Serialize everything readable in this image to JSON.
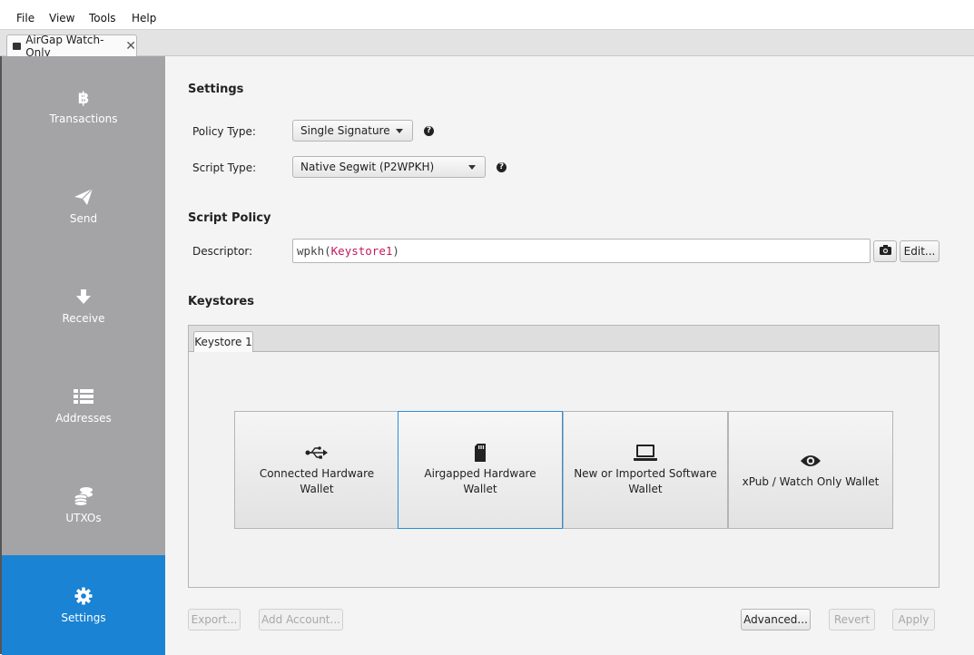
{
  "menu": [
    "File",
    "View",
    "Tools",
    "Help"
  ],
  "wallet_tab": {
    "title": "AirGap Watch-Only",
    "close": "✕"
  },
  "sidebar": {
    "items": [
      {
        "label": "Transactions",
        "icon": "bitcoin-icon",
        "active": false
      },
      {
        "label": "Send",
        "icon": "paper-plane-icon",
        "active": false
      },
      {
        "label": "Receive",
        "icon": "arrow-down-icon",
        "active": false
      },
      {
        "label": "Addresses",
        "icon": "list-icon",
        "active": false
      },
      {
        "label": "UTXOs",
        "icon": "coins-icon",
        "active": false
      },
      {
        "label": "Settings",
        "icon": "gear-icon",
        "active": true
      }
    ]
  },
  "settings": {
    "title": "Settings",
    "policy_type": {
      "label": "Policy Type:",
      "value": "Single Signature"
    },
    "script_type": {
      "label": "Script Type:",
      "value": "Native Segwit (P2WPKH)"
    }
  },
  "script_policy": {
    "title": "Script Policy",
    "descriptor_label": "Descriptor:",
    "descriptor": {
      "prefix": "wpkh(",
      "keystore": "Keystore1",
      "suffix": ")"
    },
    "edit_button": "Edit..."
  },
  "keystores": {
    "title": "Keystores",
    "tabs": [
      "Keystore 1"
    ],
    "options": [
      {
        "label": "Connected Hardware Wallet",
        "icon": "usb-icon",
        "selected": false
      },
      {
        "label": "Airgapped Hardware Wallet",
        "icon": "sd-card-icon",
        "selected": true
      },
      {
        "label": "New or Imported Software Wallet",
        "icon": "laptop-icon",
        "selected": false
      },
      {
        "label": "xPub / Watch Only Wallet",
        "icon": "eye-icon",
        "selected": false
      }
    ]
  },
  "buttons": {
    "export": "Export...",
    "add_account": "Add Account...",
    "advanced": "Advanced...",
    "revert": "Revert",
    "apply": "Apply"
  },
  "colors": {
    "accent": "#1a83d3",
    "sidebar": "#a4a4a7",
    "descriptor_keyword": "#c2185b"
  }
}
